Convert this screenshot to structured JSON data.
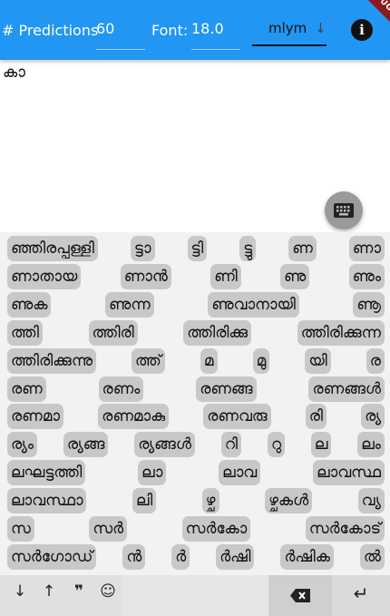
{
  "appbar": {
    "predictions_label": "# Predictions",
    "predictions_value": "60",
    "font_label": "Font:",
    "font_value": "18.0",
    "language": "mlym",
    "info_icon": "info-icon",
    "debug_banner": "DEBUG"
  },
  "editor": {
    "text": "കാ"
  },
  "suggestions": [
    [
      "ഞ്ഞിരപ്പള്ളി",
      "ട്ടാ",
      "ട്ടി",
      "ട്ടു",
      "ണ",
      "ണാ"
    ],
    [
      "ണാതായ",
      "ണാൻ",
      "ണി",
      "ണു",
      "ണും"
    ],
    [
      "ണുക",
      "ണുന്ന",
      "ണുവാനായി",
      "ണൂ"
    ],
    [
      "ത്തി",
      "ത്തിരി",
      "ത്തിരിക്കു",
      "ത്തിരിക്കുന്ന"
    ],
    [
      "ത്തിരിക്കുന്നു",
      "ത്ത്",
      "മ",
      "മു",
      "യി",
      "ര"
    ],
    [
      "രണ",
      "രണം",
      "രണങ്ങ",
      "രണങ്ങൾ"
    ],
    [
      "രണമാ",
      "രണമാകു",
      "രണവരു",
      "രി",
      "ര്യ"
    ],
    [
      "ര്യം",
      "ര്യങ്ങ",
      "ര്യങ്ങൾ",
      "റി",
      "റു",
      "ല",
      "ലം"
    ],
    [
      "ലഘട്ടത്തി",
      "ലാ",
      "ലാവ",
      "ലാവസ്ഥ"
    ],
    [
      "ലാവസ്ഥാ",
      "ലി",
      "ഴ്ച",
      "ഴ്ചകൾ",
      "വ്യ"
    ],
    [
      "സ",
      "സർ",
      "സർകോ",
      "സർകോട്"
    ],
    [
      "സർഗോഡ്",
      "ൻ",
      "ർ",
      "ർഷി",
      "ർഷിക",
      "ൽ"
    ]
  ],
  "bottom": {
    "down_arrow": "↓",
    "up_arrow": "↑",
    "quote": "❞",
    "emoji": "☺",
    "backspace_icon": "backspace-icon",
    "enter": "↵"
  },
  "colors": {
    "appbar": "#2196f3",
    "chip": "#c8c8c8",
    "debug": "#8b1a1a"
  }
}
